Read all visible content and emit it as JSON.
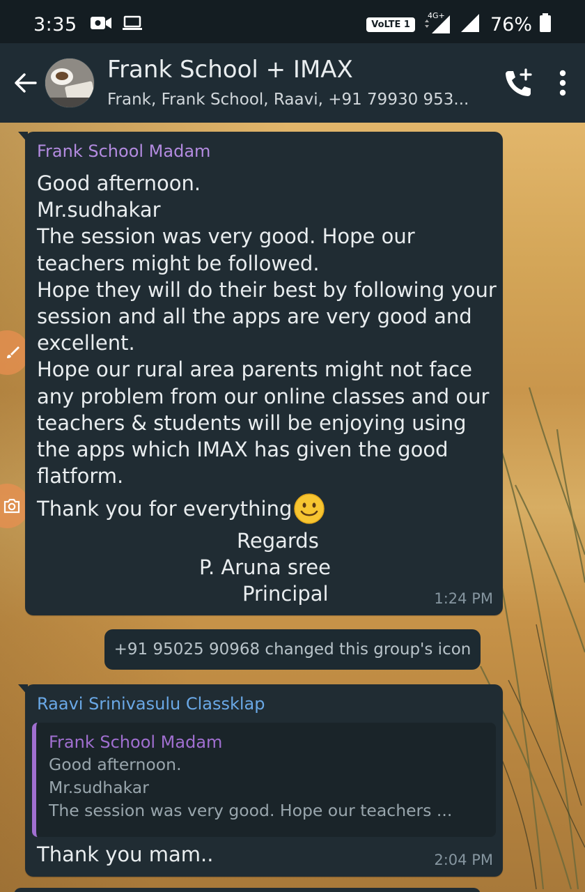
{
  "status_bar": {
    "time": "3:35",
    "network_badge": "VoLTE 1",
    "network_type": "4G+",
    "battery_percent": "76%"
  },
  "header": {
    "title": "Frank School + IMAX",
    "members": "Frank, Frank School, Raavi, +91 79930 953..."
  },
  "messages": [
    {
      "sender": "Frank School Madam",
      "sender_color": "#b38be0",
      "body": "Good afternoon.\nMr.sudhakar\nThe session was very good. Hope our teachers might be followed.\nHope they will do their best by following your session and all the apps are very good and excellent.\nHope our rural area parents might not face any problem from our online classes and our teachers & students will be enjoying using the apps which IMAX has given the good flatform.",
      "closing_line": "Thank you for everything",
      "closing_emoji": "🙂",
      "signature": [
        "Regards",
        "P. Aruna sree",
        "Principal"
      ],
      "time": "1:24 PM"
    },
    {
      "system": "+91 95025 90968 changed this group's icon"
    },
    {
      "sender": "Raavi Srinivasulu Classklap",
      "sender_color": "#6aa8e6",
      "quoted": {
        "sender": "Frank School Madam",
        "text": "Good afternoon.\nMr.sudhakar\nThe session was very good. Hope our teachers ..."
      },
      "body": "Thank you mam..",
      "time": "2:04 PM"
    }
  ],
  "icons": {
    "back": "arrow-left-icon",
    "add_call": "add-call-icon",
    "menu": "more-vert-icon",
    "video": "video-camera-icon",
    "laptop": "laptop-icon"
  },
  "colors": {
    "header_bg": "#1f2c34",
    "bubble_bg": "#202c33",
    "timestamp": "#8696a0"
  }
}
